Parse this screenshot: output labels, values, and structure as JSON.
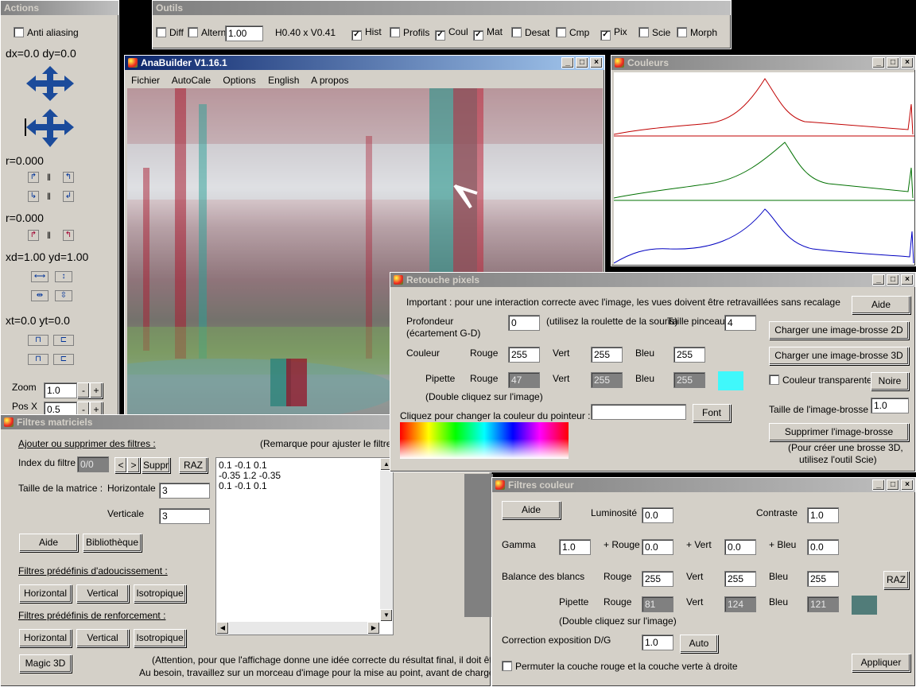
{
  "actions": {
    "title": "Actions",
    "anti_aliasing": "Anti aliasing",
    "dxdy": "dx=0.0 dy=0.0",
    "r1": "r=0.000",
    "r2": "r=0.000",
    "xdyd": "xd=1.00 yd=1.00",
    "xtyt": "xt=0.0 yt=0.0",
    "zoom_label": "Zoom",
    "zoom_value": "1.0",
    "posx_label": "Pos X",
    "posx_value": "0.5",
    "minus": "-",
    "plus": "+"
  },
  "outils": {
    "title": "Outils",
    "diff": "Diff",
    "altern": "Altern",
    "altern_value": "1.00",
    "hv": "H0.40 x V0.41",
    "hist": "Hist",
    "profils": "Profils",
    "coul": "Coul",
    "mat": "Mat",
    "desat": "Desat",
    "cmp": "Cmp",
    "pix": "Pix",
    "scie": "Scie",
    "morph": "Morph"
  },
  "anabuilder": {
    "title": "AnaBuilder V1.16.1",
    "menu": [
      "Fichier",
      "AutoCale",
      "Options",
      "English",
      "A propos"
    ]
  },
  "couleurs": {
    "title": "Couleurs"
  },
  "retouche": {
    "title": "Retouche pixels",
    "important": "Important : pour une interaction correcte avec l'image, les vues doivent être retravaillées sans recalage",
    "aide": "Aide",
    "profondeur": "Profondeur",
    "ecartement": "(écartement G-D)",
    "profondeur_value": "0",
    "roulette": "(utilisez la roulette de la souris)",
    "taille_pinceau": "Taille pinceau",
    "taille_pinceau_value": "4",
    "charger2d": "Charger une image-brosse 2D",
    "charger3d": "Charger une image-brosse 3D",
    "couleur": "Couleur",
    "rouge": "Rouge",
    "vert": "Vert",
    "bleu": "Bleu",
    "couleur_r": "255",
    "couleur_v": "255",
    "couleur_b": "255",
    "pipette": "Pipette",
    "pipette_r": "47",
    "pipette_v": "255",
    "pipette_b": "255",
    "pipette_color": "#40f8fb",
    "double_clic": "(Double cliquez sur l'image)",
    "couleur_transparente": "Couleur transparente",
    "noire": "Noire",
    "cliquez_couleur": "Cliquez pour changer la couleur du pointeur :",
    "font": "Font",
    "taille_brosse": "Taille de l'image-brosse",
    "taille_brosse_value": "1.0",
    "supprimer_brosse": "Supprimer l'image-brosse",
    "pour_creer": "(Pour créer une brosse 3D,",
    "utilisez_scie": "utilisez l'outil Scie)"
  },
  "filtres_mat": {
    "title": "Filtres matriciels",
    "ajouter": "Ajouter ou supprimer des filtres :",
    "remarque": "(Remarque pour ajuster le filtre : plu",
    "index": "Index du filtre",
    "index_value": "0/0",
    "prev": "<",
    "next": ">",
    "suppr": "Suppr",
    "raz": "RAZ",
    "taille_matrice": "Taille de la matrice :",
    "horizontale": "Horizontale",
    "horizontale_value": "3",
    "verticale": "Verticale",
    "verticale_value": "3",
    "matrix_lines": [
      "0.1 -0.1 0.1",
      "-0.35 1.2 -0.35",
      "0.1 -0.1 0.1"
    ],
    "aide": "Aide",
    "bibliotheque": "Bibliothèque",
    "adoucissement": "Filtres prédéfinis d'adoucissement :",
    "renforcement": "Filtres prédéfinis de renforcement :",
    "horizontal": "Horizontal",
    "vertical": "Vertical",
    "isotropique": "Isotropique",
    "magic3d": "Magic 3D",
    "attention": "(Attention, pour que l'affichage donne une idée correcte du résultat final, il doit être à l'éche",
    "au_besoin": "Au besoin, travaillez sur un morceau d'image pour la mise au point, avant de charger l'image co"
  },
  "filtres_coul": {
    "title": "Filtres couleur",
    "aide": "Aide",
    "luminosite": "Luminosité",
    "luminosite_value": "0.0",
    "contraste": "Contraste",
    "contraste_value": "1.0",
    "gamma": "Gamma",
    "gamma_value": "1.0",
    "plus_rouge": "+ Rouge",
    "plus_rouge_value": "0.0",
    "plus_vert": "+ Vert",
    "plus_vert_value": "0.0",
    "plus_bleu": "+ Bleu",
    "plus_bleu_value": "0.0",
    "balance": "Balance des blancs",
    "rouge": "Rouge",
    "vert": "Vert",
    "bleu": "Bleu",
    "bal_r": "255",
    "bal_v": "255",
    "bal_b": "255",
    "raz": "RAZ",
    "pipette": "Pipette",
    "pip_r": "81",
    "pip_v": "124",
    "pip_b": "121",
    "pipette_color": "#517c79",
    "double_clic": "(Double cliquez sur l'image)",
    "correction": "Correction exposition D/G",
    "correction_value": "1.0",
    "auto": "Auto",
    "permuter": "Permuter la couche rouge et la couche verte à droite",
    "appliquer": "Appliquer"
  },
  "colors": {
    "title_active": "#0a246a",
    "title_inactive": "#808080",
    "hist_red": "#c00000",
    "hist_green": "#007000",
    "hist_blue": "#0000c0"
  }
}
